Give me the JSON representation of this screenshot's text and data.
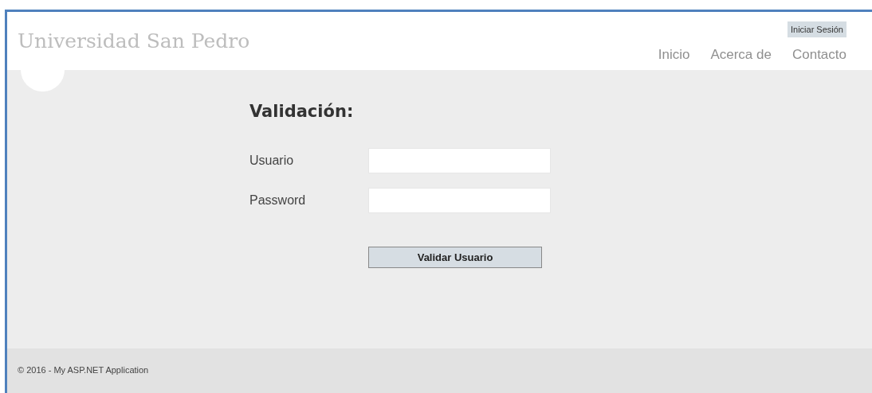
{
  "header": {
    "site_title": "Universidad San Pedro",
    "login_link": "Iniciar Sesión",
    "nav": [
      {
        "label": "Inicio"
      },
      {
        "label": "Acerca de"
      },
      {
        "label": "Contacto"
      }
    ]
  },
  "form": {
    "heading": "Validación:",
    "fields": [
      {
        "label": "Usuario"
      },
      {
        "label": "Password"
      }
    ],
    "submit": "Validar Usuario"
  },
  "footer": {
    "text": "© 2016 - My ASP.NET Application"
  }
}
